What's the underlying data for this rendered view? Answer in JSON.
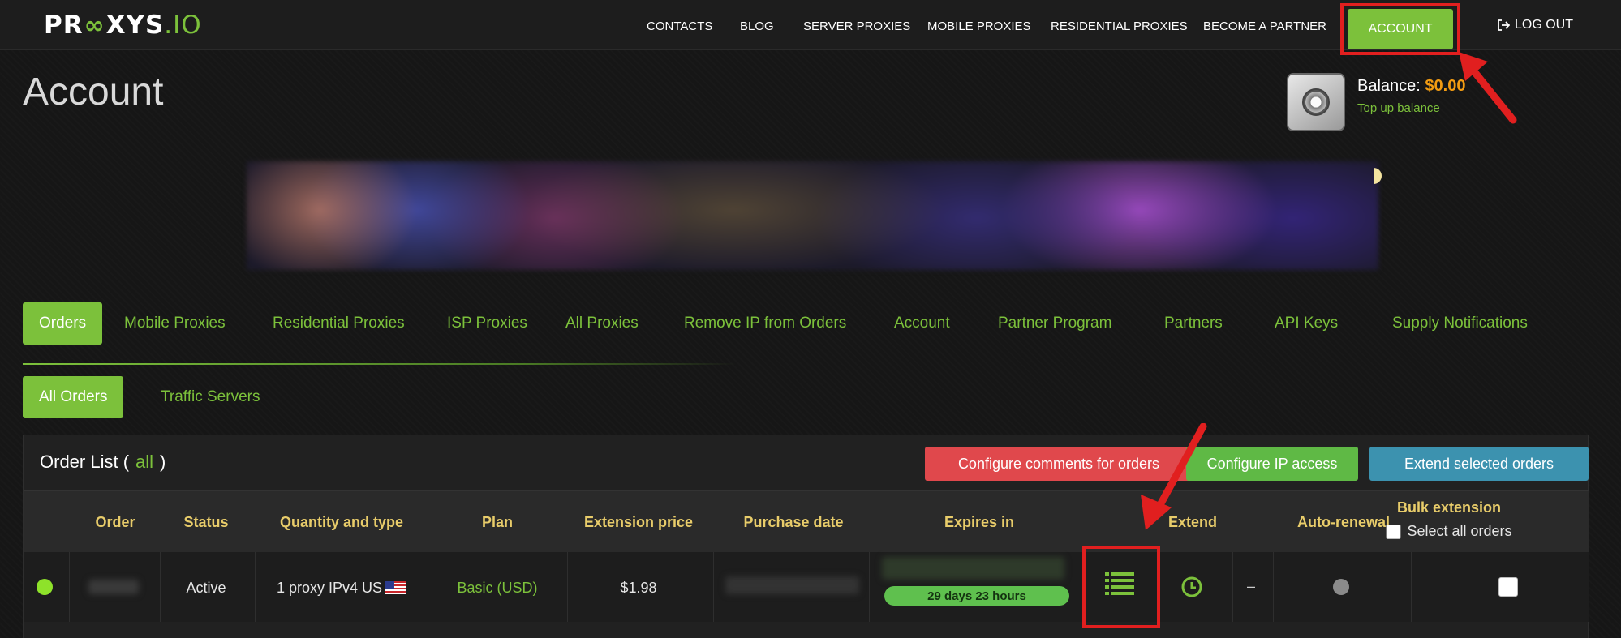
{
  "brand": {
    "logo_left": "PR",
    "logo_mid": "XYS",
    "logo_right": ".IO"
  },
  "nav": {
    "items": [
      "CONTACTS",
      "BLOG",
      "SERVER PROXIES",
      "MOBILE PROXIES",
      "RESIDENTIAL PROXIES",
      "BECOME A PARTNER"
    ],
    "account": "ACCOUNT",
    "logout": "LOG OUT"
  },
  "header": {
    "title": "Account",
    "balance_label": "Balance: ",
    "balance_value": "$0.00",
    "topup": "Top up balance"
  },
  "tabs": [
    "Orders",
    "Mobile Proxies",
    "Residential Proxies",
    "ISP Proxies",
    "All Proxies",
    "Remove IP from Orders",
    "Account",
    "Partner Program",
    "Partners",
    "API Keys",
    "Supply Notifications"
  ],
  "subtabs": [
    "All Orders",
    "Traffic Servers"
  ],
  "orders": {
    "title": "Order List (",
    "filter": "all",
    "title_end": ")",
    "buttons": {
      "comments": "Configure comments for orders",
      "ip_access": "Configure IP access",
      "extend_selected": "Extend selected orders"
    },
    "columns": [
      "Order",
      "Status",
      "Quantity and type",
      "Plan",
      "Extension price",
      "Purchase date",
      "Expires in",
      "Extend",
      "Auto-renewal"
    ],
    "bulk_label": "Bulk extension",
    "select_all": "Select all orders",
    "row": {
      "status": "Active",
      "quantity": "1 proxy IPv4 US",
      "plan": "Basic (USD)",
      "price": "$1.98",
      "expires": "29 days 23 hours",
      "autorenew_dash": "–"
    }
  },
  "colors": {
    "accent": "#7cc13b",
    "highlight": "#e11f1f",
    "header_text": "#e8cc6a"
  }
}
